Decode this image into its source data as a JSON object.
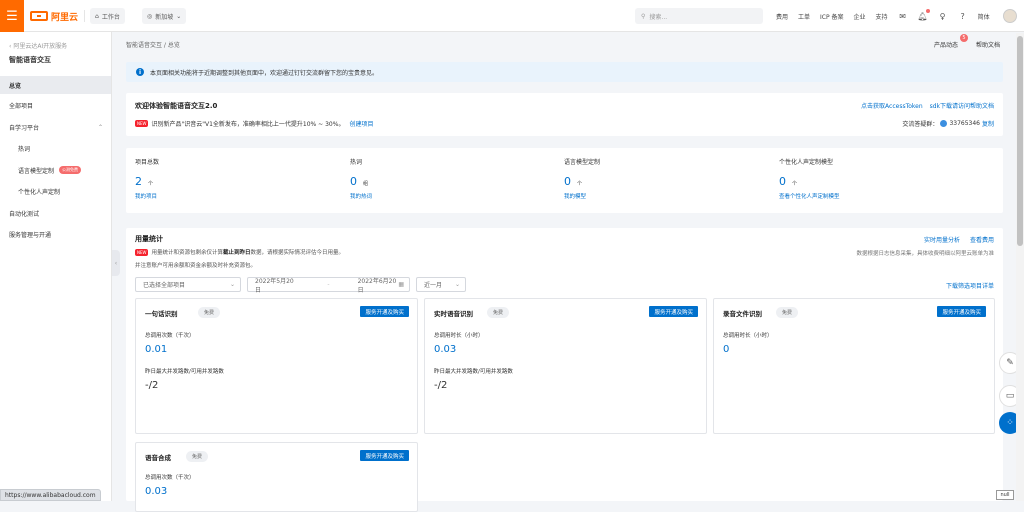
{
  "topbar": {
    "brand": "阿里云",
    "workbench": "工作台",
    "region": "新加坡",
    "search_placeholder": "搜索...",
    "links": [
      "费用",
      "工单",
      "ICP 备案",
      "企业",
      "支持"
    ],
    "lang": "简体"
  },
  "sidebar": {
    "back": "阿里云达AI开放服务",
    "title": "智能语音交互",
    "items": [
      {
        "label": "总览"
      },
      {
        "label": "全部项目"
      },
      {
        "label": "自学习平台"
      },
      {
        "label": "热词"
      },
      {
        "label": "语言模型定制",
        "badge": "公测免费"
      },
      {
        "label": "个性化人声定制"
      },
      {
        "label": "自动化测试"
      },
      {
        "label": "服务管理与开通"
      }
    ]
  },
  "header": {
    "breadcrumb": "智能语音交互 / 总览",
    "product_news": "产品动态",
    "news_badge": "5",
    "help": "帮助文档"
  },
  "notice": {
    "text": "本页面相关功能将于近期调整到其他页面中，欢迎通过钉钉交流群留下您的宝贵意见。"
  },
  "welcome": {
    "title": "欢迎体验智能语音交互2.0",
    "tag": "NEW",
    "text": "识别新产品\"识音云\"V1全新发布，准确率相比上一代提升10% ~ 30%。",
    "create_link": "创建项目",
    "access_token_link": "点击获取AccessToken",
    "sdk_link": "sdk下载请访问帮助文档",
    "group_label": "交流答疑群：",
    "group_id": "33765346",
    "copy": "复制"
  },
  "stats": [
    {
      "label": "项目总数",
      "value": "2",
      "unit": "个",
      "link": "我的项目"
    },
    {
      "label": "热词",
      "value": "0",
      "unit": "组",
      "link": "我的热词"
    },
    {
      "label": "语言模型定制",
      "value": "0",
      "unit": "个",
      "link": "我的模型"
    },
    {
      "label": "个性化人声定制模型",
      "value": "0",
      "unit": "个",
      "link": "查看个性化人声定制模型"
    }
  ],
  "usage": {
    "title": "用量统计",
    "tag": "NEW",
    "line1_a": "用量统计和资源包剩余仅计算",
    "line1_b": "截止到昨日",
    "line1_c": "数据，请根据实际情况评估今日用量。",
    "line2": "并注意账户可用余额和资金余额及时补充资源包。",
    "realtime_link": "实时用量分析",
    "billing_link": "查看费用",
    "right_note": "数据根据日志信息采集，具体收费明细以阿里云账单为准",
    "project_select": "已选择全部项目",
    "date_start": "2022年5月20日",
    "date_end": "2022年6月20日",
    "range_select": "近一月",
    "download": "下载筛选项目详单",
    "buy_label": "服务开通及购买",
    "free_label": "免费"
  },
  "services": [
    {
      "name": "一句话识别",
      "m1": "总调用次数（千次）",
      "v1": "0.01",
      "m2": "昨日最大并发路数/可用并发路数",
      "v2": "-/2"
    },
    {
      "name": "实时语音识别",
      "m1": "总调用时长（小时）",
      "v1": "0.03",
      "m2": "昨日最大并发路数/可用并发路数",
      "v2": "-/2"
    },
    {
      "name": "录音文件识别",
      "m1": "总调用时长（小时）",
      "v1": "0",
      "m2": "",
      "v2": ""
    },
    {
      "name": "语音合成",
      "m1": "总调用次数（千次）",
      "v1": "0.03",
      "m2": "",
      "v2": ""
    }
  ],
  "status_url": "https://www.alibabacloud.com",
  "null_text": "null",
  "colors": {
    "brand": "#ff6a00",
    "primary": "#0070cc",
    "danger": "#f56c6c"
  }
}
